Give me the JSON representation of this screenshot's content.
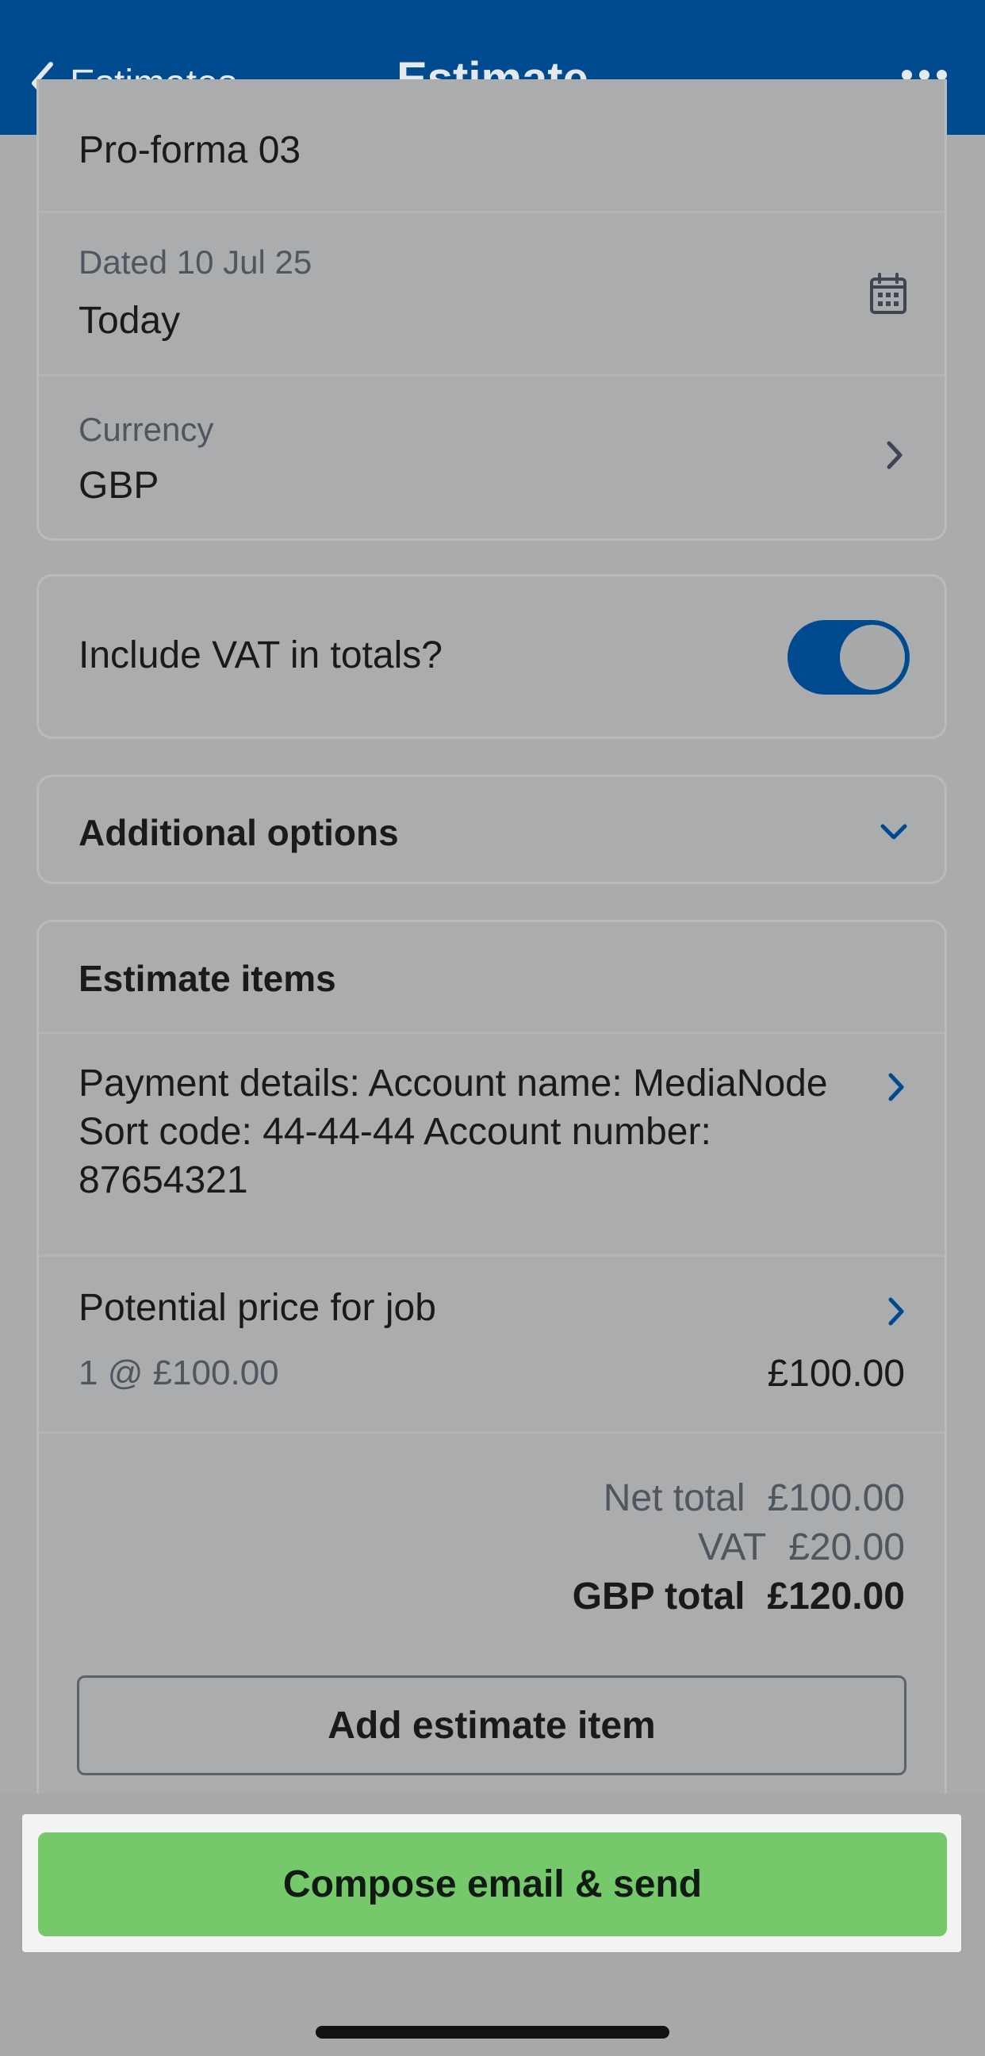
{
  "header": {
    "back_label": "Estimates",
    "title": "Estimate",
    "more_icon": "more-horizontal-icon"
  },
  "details": {
    "reference": "Pro-forma 03",
    "date_label": "Dated 10 Jul 25",
    "date_value": "Today",
    "date_icon": "calendar-icon",
    "currency_label": "Currency",
    "currency_value": "GBP"
  },
  "vat": {
    "label": "Include VAT in totals?",
    "enabled": true
  },
  "additional_options": {
    "label": "Additional options"
  },
  "estimate_items": {
    "heading": "Estimate items",
    "items": [
      {
        "description": "Payment details: Account name: MediaNode Sort code: 44-44-44 Account number: 87654321"
      },
      {
        "description": "Potential price for job",
        "quantity_price": "1 @ £100.00",
        "amount": "£100.00"
      }
    ],
    "totals": {
      "net_label": "Net total",
      "net_value": "£100.00",
      "vat_label": "VAT",
      "vat_value": "£20.00",
      "gross_label": "GBP total",
      "gross_value": "£120.00"
    },
    "add_button": "Add estimate item"
  },
  "footer": {
    "send_button": "Compose email & send"
  },
  "colors": {
    "header_bg": "#004a8f",
    "accent": "#004a8f",
    "send_button": "#76c96b"
  }
}
